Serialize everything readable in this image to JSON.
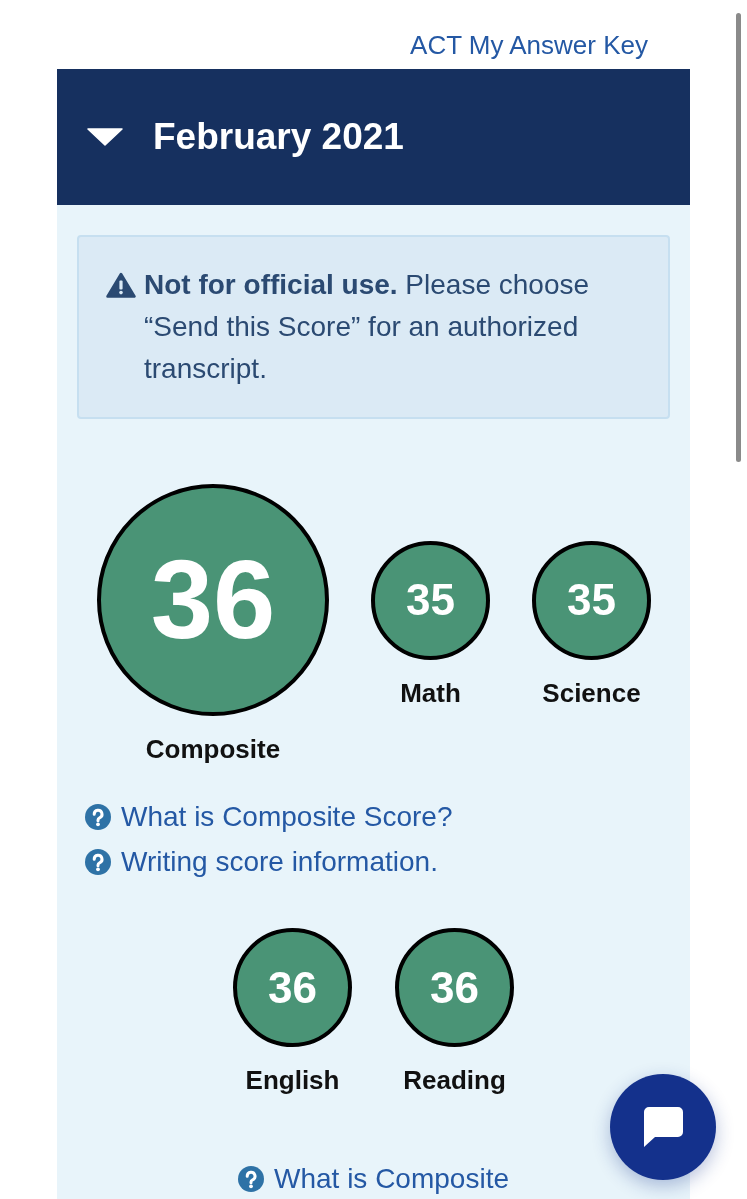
{
  "top_link": {
    "label": "ACT My Answer Key"
  },
  "test_date": {
    "title": "February 2021",
    "expanded": true
  },
  "notice": {
    "text": "**Not for official use.** Please choose “Send this Score” for an authorized transcript."
  },
  "main_scores": [
    {
      "kind": "large",
      "value": "36",
      "label": "Composite"
    },
    {
      "kind": "small",
      "value": "35",
      "label": "Math"
    },
    {
      "kind": "small",
      "value": "35",
      "label": "Science"
    }
  ],
  "help_links": [
    "What is Composite Score?",
    "Writing score information."
  ],
  "section_scores": [
    {
      "kind": "small",
      "value": "36",
      "label": "English"
    },
    {
      "kind": "small",
      "value": "36",
      "label": "Reading"
    }
  ],
  "bottom_help_link": "What is Composite"
}
